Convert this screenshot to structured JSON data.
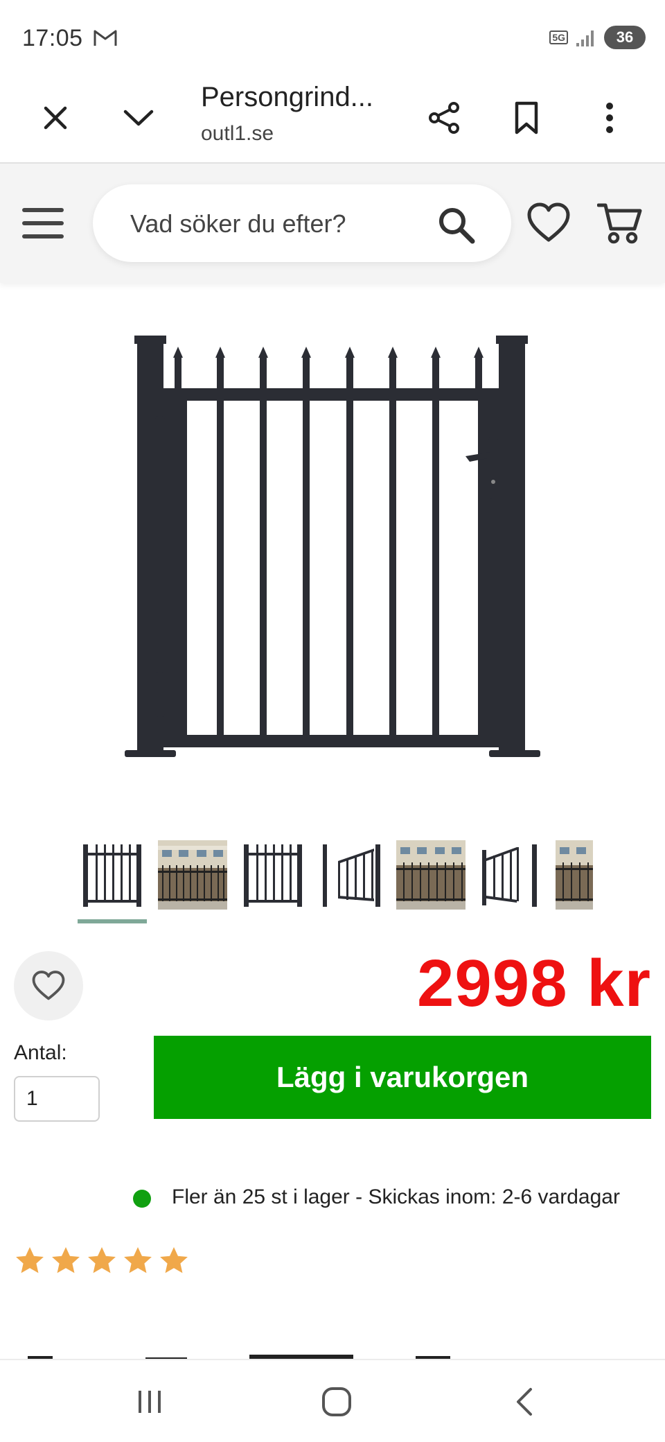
{
  "status_bar": {
    "time": "17:05",
    "network": "5G",
    "battery": "36"
  },
  "browser": {
    "tab_title": "Persongrind...",
    "url": "outl1.se"
  },
  "header": {
    "search_placeholder": "Vad söker du efter?"
  },
  "product": {
    "price": "2998  kr",
    "quantity_label": "Antal:",
    "quantity_value": "1",
    "add_to_cart_label": "Lägg i varukorgen",
    "stock_text": "Fler än 25 st i lager - Skickas inom: 2-6 vardagar",
    "rating": 5,
    "thumbnail_count": 7,
    "selected_thumbnail": 1
  },
  "colors": {
    "price": "#ee1111",
    "add_to_cart": "#05a000",
    "stock_dot": "#10a010",
    "star": "#f0a84a",
    "gate": "#2b2d34"
  },
  "icons": {
    "close": "close-icon",
    "collapse": "chevron-down-icon",
    "share": "share-icon",
    "bookmark": "bookmark-icon",
    "more": "more-vertical-icon",
    "menu": "hamburger-menu-icon",
    "search": "search-icon",
    "wishlist": "heart-icon",
    "cart": "cart-icon"
  }
}
